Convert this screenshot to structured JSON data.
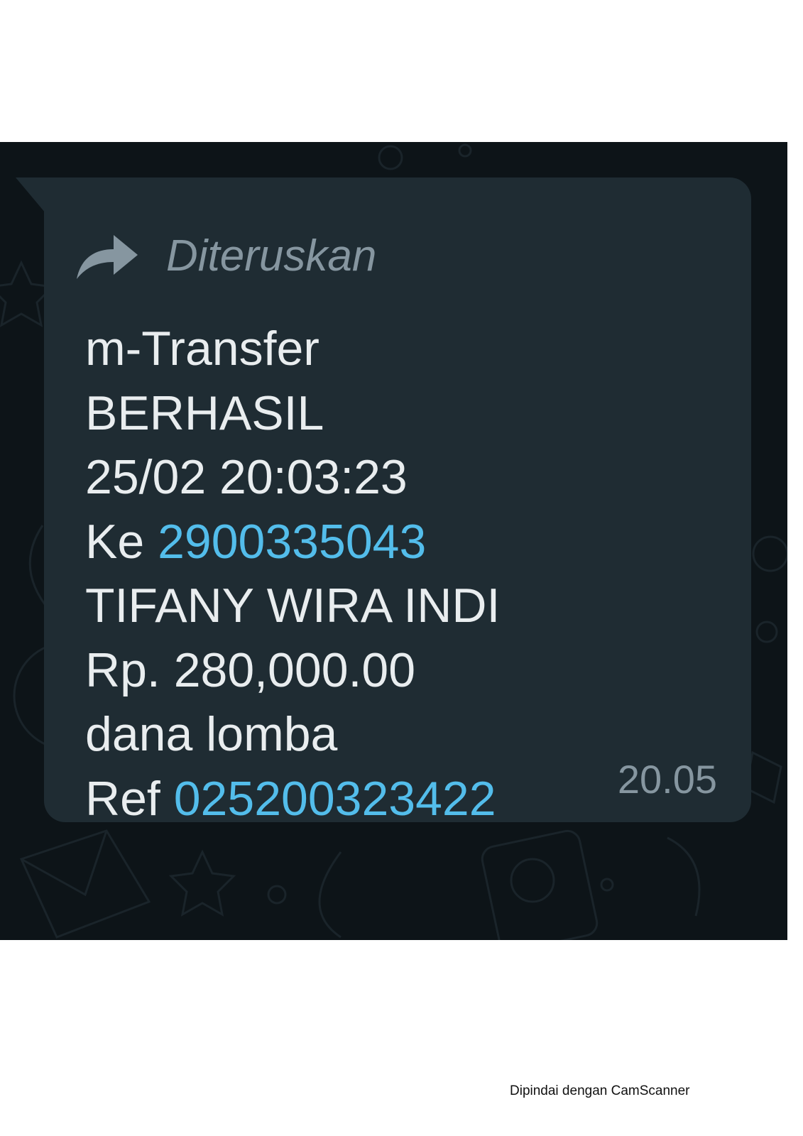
{
  "message": {
    "forwarded_label": "Diteruskan",
    "forward_icon": "forward-arrow-icon",
    "lines": {
      "title": "m-Transfer",
      "status": "BERHASIL",
      "datetime": "25/02 20:03:23",
      "to_prefix": "Ke",
      "to_account": "2900335043",
      "recipient": "TIFANY WIRA INDI",
      "amount": "Rp. 280,000.00",
      "note": "dana lomba",
      "ref_prefix": "Ref",
      "ref_number": "025200323422"
    },
    "time": "20.05"
  },
  "footer": {
    "scanner_note": "Dipindai dengan CamScanner"
  },
  "colors": {
    "background": "#0d1418",
    "bubble": "#1f2c33",
    "text": "#e9edef",
    "meta": "#8696a0",
    "link": "#53bdeb"
  }
}
